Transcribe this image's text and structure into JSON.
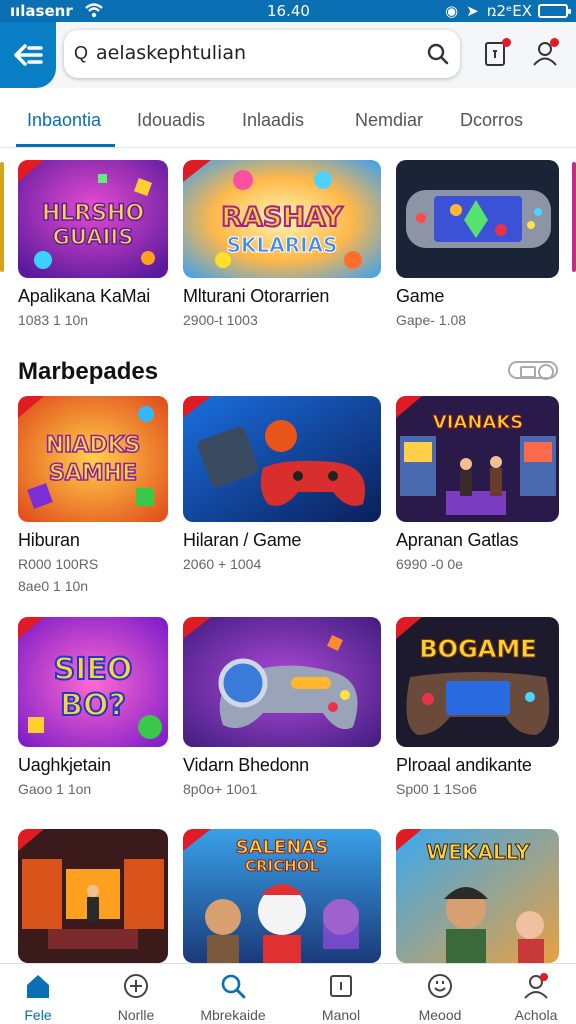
{
  "status_bar": {
    "carrier": "ıılasenr",
    "time": "16.40",
    "battery_text": "ռ2ᵉEX"
  },
  "header": {
    "search_value": "aelaskephtulian",
    "search_lead": "Q"
  },
  "tabs": [
    {
      "label": "Inbaontia"
    },
    {
      "label": "Idouadis"
    },
    {
      "label": "Inlaadis"
    },
    {
      "label": "Nemdiar"
    },
    {
      "label": "Dcorros"
    }
  ],
  "featured": [
    {
      "title": "Apalikana KaMai",
      "sub": "1083 1 10n",
      "art": "HLRSHO GUAIIS"
    },
    {
      "title": "Mlturani Otorarrien",
      "sub": "2900-t 1003",
      "art": "RASHAY SKLARIAS"
    },
    {
      "title": "Game",
      "sub": "Gape- 1.08",
      "art": ""
    }
  ],
  "section": {
    "title": "Marbepades"
  },
  "grid": [
    {
      "title": "Hiburan",
      "sub": "R000 100RS",
      "sub2": "8ae0 1 10n",
      "art": "NIADKS SAMHE"
    },
    {
      "title": "Hilaran / Game",
      "sub": "2060 + 1004",
      "sub2": "",
      "art": ""
    },
    {
      "title": "Apranan Gatlas",
      "sub": "6990 -0 0e",
      "sub2": "",
      "art": "VIANAKS"
    },
    {
      "title": "Uaghkjetain",
      "sub": "Gaoo 1 1on",
      "sub2": "",
      "art": "SIEO BO?"
    },
    {
      "title": "Vidarn Bhedonn",
      "sub": "8p0o+ 10o1",
      "sub2": "",
      "art": ""
    },
    {
      "title": "Plroaal andikante",
      "sub": "Sp00 1 1So6",
      "sub2": "",
      "art": "BOGAME"
    },
    {
      "title": "",
      "sub": "",
      "sub2": "",
      "art": ""
    },
    {
      "title": "",
      "sub": "",
      "sub2": "",
      "art": "SALENAS CRICHOL"
    },
    {
      "title": "",
      "sub": "",
      "sub2": "",
      "art": "WEKALLY"
    }
  ],
  "bottom_nav": [
    {
      "label": "Fele",
      "icon": "home-icon"
    },
    {
      "label": "Norlle",
      "icon": "add-circle-icon"
    },
    {
      "label": "Mbrekaide",
      "icon": "search-icon"
    },
    {
      "label": "Manol",
      "icon": "tablet-icon"
    },
    {
      "label": "Meood",
      "icon": "smiley-icon"
    },
    {
      "label": "Achola",
      "icon": "profile-icon"
    }
  ],
  "colors": {
    "brand": "#0a6fb3",
    "accent_red": "#e01b24",
    "background": "#ffffff"
  }
}
